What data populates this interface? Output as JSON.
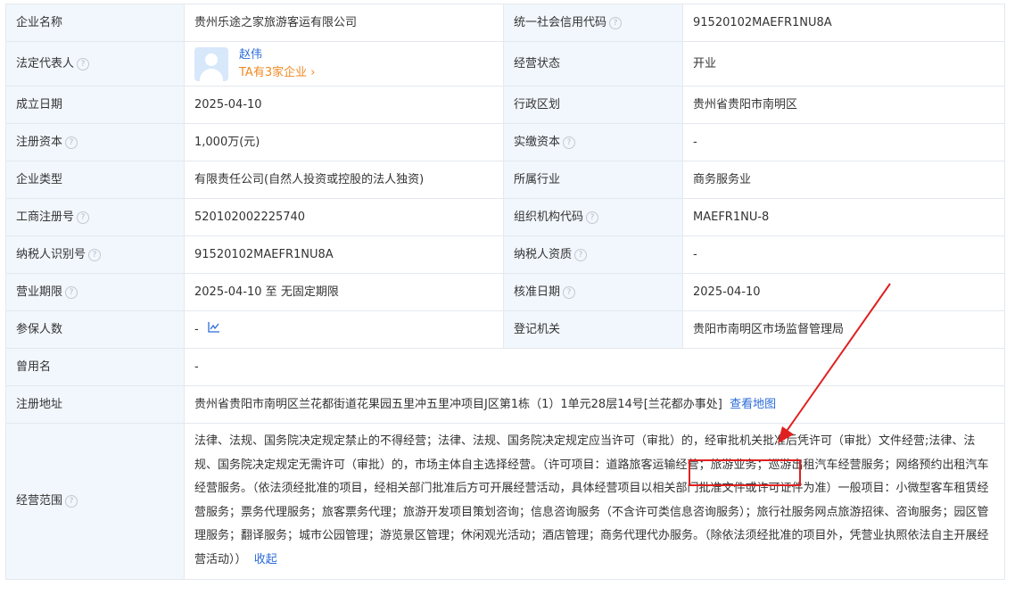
{
  "rows": [
    {
      "l1": "企业名称",
      "v1": "贵州乐途之家旅游客运有限公司",
      "l2": "统一社会信用代码",
      "v2": "91520102MAEFR1NU8A"
    },
    {
      "l1": "法定代表人",
      "legal_name": "赵伟",
      "legal_sub": "TA有3家企业 ›",
      "l2": "经营状态",
      "v2": "开业"
    },
    {
      "l1": "成立日期",
      "v1": "2025-04-10",
      "l2": "行政区划",
      "v2": "贵州省贵阳市南明区"
    },
    {
      "l1": "注册资本",
      "v1": "1,000万(元)",
      "l2": "实缴资本",
      "v2": "-"
    },
    {
      "l1": "企业类型",
      "v1": "有限责任公司(自然人投资或控股的法人独资)",
      "l2": "所属行业",
      "v2": "商务服务业"
    },
    {
      "l1": "工商注册号",
      "v1": "520102002225740",
      "l2": "组织机构代码",
      "v2": "MAEFR1NU-8"
    },
    {
      "l1": "纳税人识别号",
      "v1": "91520102MAEFR1NU8A",
      "l2": "纳税人资质",
      "v2": "-"
    },
    {
      "l1": "营业期限",
      "v1": "2025-04-10 至 无固定期限",
      "l2": "核准日期",
      "v2": "2025-04-10"
    },
    {
      "l1": "参保人数",
      "v1": "-",
      "l2": "登记机关",
      "v2": "贵阳市南明区市场监督管理局"
    },
    {
      "l1": "曾用名",
      "v1": "-"
    },
    {
      "l1": "注册地址",
      "v1": "贵州省贵阳市南明区兰花都街道花果园五里冲五里冲项目J区第1栋（1）1单元28层14号[兰花都办事处]",
      "link": "查看地图"
    },
    {
      "l1": "经营范围",
      "scope_a": "法律、法规、国务院决定规定禁止的不得经营；法律、法规、国务院决定规定应当许可（审批）的，经审批机关批准后凭许可（审批）文件经营;法律、法规、国务院决定规定无需许可（审批）的，市场主体自主选择经营。（许可项目：",
      "scope_highlight": "道路旅客运输经营",
      "scope_b": "；旅游业务；巡游出租汽车经营服务；网络预约出租汽车经营服务。（依法须经批准的项目，经相关部门批准后方可开展经营活动，具体经营项目以相关部门批准文件或许可证件为准）一般项目：小微型客车租赁经营服务；票务代理服务；旅客票务代理；旅游开发项目策划咨询；信息咨询服务（不含许可类信息咨询服务）；旅行社服务网点旅游招徕、咨询服务；园区管理服务；翻译服务；城市公园管理；游览景区管理；休闲观光活动；酒店管理；商务代理代办服务。（除依法须经批准的项目外，凭营业执照依法自主开展经营活动））",
      "collapse": "收起"
    }
  ],
  "colors": {
    "label_bg": "#f2f7fd",
    "border": "#e4e9ef",
    "link": "#2b6cd8",
    "orange": "#f08a24",
    "annotation": "#e02020"
  },
  "icons": [
    "help-icon",
    "avatar-icon",
    "trend-chart-icon",
    "arrow-annotation"
  ]
}
